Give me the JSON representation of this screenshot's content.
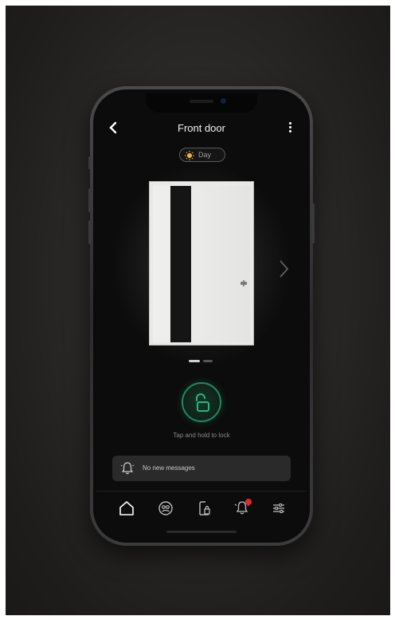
{
  "screen": {
    "title": "Front door",
    "mode_label": "Day",
    "lock_hint": "Tap and hold to lock",
    "messages_text": "No new messages"
  },
  "icons": {
    "back": "chevron-left-icon",
    "more": "vertical-dots-icon",
    "mode": "sun-icon",
    "next": "chevron-right-icon",
    "lock": "unlocked-padlock-icon",
    "messages": "bell-icon"
  },
  "nav": {
    "items": [
      {
        "name": "home",
        "icon": "home-icon",
        "active": true
      },
      {
        "name": "profiles",
        "icon": "profile-icon",
        "active": false
      },
      {
        "name": "access",
        "icon": "door-access-icon",
        "active": false
      },
      {
        "name": "notifications",
        "icon": "bell-icon",
        "active": false,
        "badge": true
      },
      {
        "name": "settings",
        "icon": "sliders-icon",
        "active": false
      }
    ]
  },
  "carousel": {
    "pages": 2,
    "current": 1
  },
  "colors": {
    "accent_green": "#1f8a62",
    "badge_red": "#e4262d",
    "screen_bg": "#0c0c0c"
  }
}
